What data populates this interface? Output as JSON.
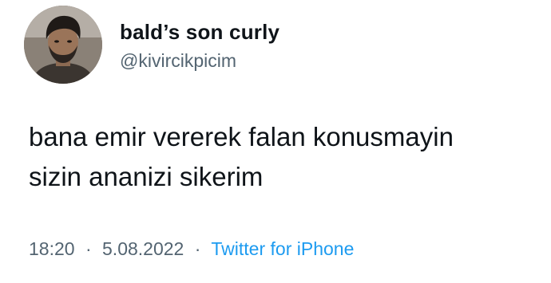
{
  "author": {
    "display_name": "bald’s son curly",
    "handle": "@kivircikpicim",
    "avatar_icon": "profile-photo"
  },
  "tweet": {
    "lines": [
      "bana emir vererek falan konusmayin",
      "sizin ananizi sikerim"
    ],
    "time": "18:20",
    "date": "5.08.2022",
    "separator": "·",
    "client": "Twitter for iPhone"
  },
  "colors": {
    "text": "#0f1419",
    "secondary": "#536471",
    "link": "#1d9bf0",
    "background": "#ffffff"
  }
}
